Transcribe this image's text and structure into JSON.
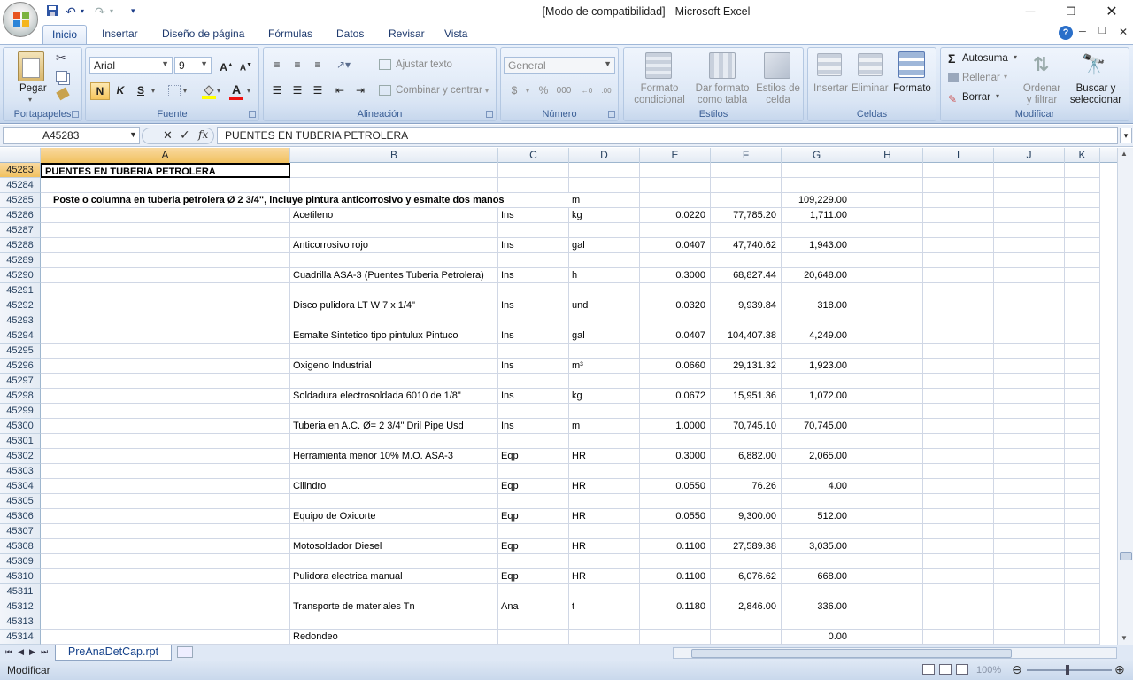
{
  "window": {
    "title": "[Modo de compatibilidad] - Microsoft Excel"
  },
  "ribbon": {
    "tabs": [
      "Inicio",
      "Insertar",
      "Diseño de página",
      "Fórmulas",
      "Datos",
      "Revisar",
      "Vista"
    ],
    "clipboard": {
      "paste": "Pegar",
      "group": "Portapapeles"
    },
    "font": {
      "name": "Arial",
      "size": "9",
      "bold": "N",
      "italic": "K",
      "underline": "S",
      "group": "Fuente"
    },
    "alignment": {
      "wrap": "Ajustar texto",
      "merge": "Combinar y centrar",
      "group": "Alineación"
    },
    "number": {
      "format": "General",
      "currency": "$",
      "percent": "%",
      "thousands": "000",
      "group": "Número"
    },
    "styles": {
      "cond": "Formato condicional",
      "table": "Dar formato como tabla",
      "cell": "Estilos de celda",
      "group": "Estilos"
    },
    "cells": {
      "insert": "Insertar",
      "delete": "Eliminar",
      "format": "Formato",
      "group": "Celdas"
    },
    "editing": {
      "autosum": "Autosuma",
      "fill": "Rellenar",
      "clear": "Borrar",
      "sort": "Ordenar y filtrar",
      "find": "Buscar y seleccionar",
      "group": "Modificar"
    }
  },
  "formula_bar": {
    "name_box": "A45283",
    "content": "PUENTES EN TUBERIA PETROLERA"
  },
  "columns": [
    "A",
    "B",
    "C",
    "D",
    "E",
    "F",
    "G",
    "H",
    "I",
    "J",
    "K"
  ],
  "rows": [
    {
      "n": "45283",
      "a": "PUENTES EN TUBERIA PETROLERA",
      "b": "",
      "c": "",
      "d": "",
      "e": "",
      "f": "",
      "g": ""
    },
    {
      "n": "45284",
      "a": "",
      "b": "",
      "c": "",
      "d": "",
      "e": "",
      "f": "",
      "g": ""
    },
    {
      "n": "45285",
      "a": "Poste o columna en tuberia petrolera Ø 2 3/4\", incluye pintura anticorrosivo y esmalte dos manos",
      "b": "",
      "c": "",
      "d": "m",
      "e": "",
      "f": "",
      "g": "109,229.00"
    },
    {
      "n": "45286",
      "a": "",
      "b": "Acetileno",
      "c": "Ins",
      "d": "kg",
      "e": "0.0220",
      "f": "77,785.20",
      "g": "1,711.00"
    },
    {
      "n": "45287",
      "a": "",
      "b": "",
      "c": "",
      "d": "",
      "e": "",
      "f": "",
      "g": ""
    },
    {
      "n": "45288",
      "a": "",
      "b": "Anticorrosivo rojo",
      "c": "Ins",
      "d": "gal",
      "e": "0.0407",
      "f": "47,740.62",
      "g": "1,943.00"
    },
    {
      "n": "45289",
      "a": "",
      "b": "",
      "c": "",
      "d": "",
      "e": "",
      "f": "",
      "g": ""
    },
    {
      "n": "45290",
      "a": "",
      "b": "Cuadrilla ASA-3 (Puentes Tuberia Petrolera)",
      "c": "Ins",
      "d": "h",
      "e": "0.3000",
      "f": "68,827.44",
      "g": "20,648.00"
    },
    {
      "n": "45291",
      "a": "",
      "b": "",
      "c": "",
      "d": "",
      "e": "",
      "f": "",
      "g": ""
    },
    {
      "n": "45292",
      "a": "",
      "b": "Disco pulidora LT W 7 x 1/4\"",
      "c": "Ins",
      "d": "und",
      "e": "0.0320",
      "f": "9,939.84",
      "g": "318.00"
    },
    {
      "n": "45293",
      "a": "",
      "b": "",
      "c": "",
      "d": "",
      "e": "",
      "f": "",
      "g": ""
    },
    {
      "n": "45294",
      "a": "",
      "b": "Esmalte Sintetico tipo pintulux Pintuco",
      "c": "Ins",
      "d": "gal",
      "e": "0.0407",
      "f": "104,407.38",
      "g": "4,249.00"
    },
    {
      "n": "45295",
      "a": "",
      "b": "",
      "c": "",
      "d": "",
      "e": "",
      "f": "",
      "g": ""
    },
    {
      "n": "45296",
      "a": "",
      "b": "Oxigeno Industrial",
      "c": "Ins",
      "d": "m³",
      "e": "0.0660",
      "f": "29,131.32",
      "g": "1,923.00"
    },
    {
      "n": "45297",
      "a": "",
      "b": "",
      "c": "",
      "d": "",
      "e": "",
      "f": "",
      "g": ""
    },
    {
      "n": "45298",
      "a": "",
      "b": "Soldadura electrosoldada 6010 de 1/8\"",
      "c": "Ins",
      "d": "kg",
      "e": "0.0672",
      "f": "15,951.36",
      "g": "1,072.00"
    },
    {
      "n": "45299",
      "a": "",
      "b": "",
      "c": "",
      "d": "",
      "e": "",
      "f": "",
      "g": ""
    },
    {
      "n": "45300",
      "a": "",
      "b": "Tuberia en A.C. Ø= 2 3/4\" Dril Pipe Usd",
      "c": "Ins",
      "d": "m",
      "e": "1.0000",
      "f": "70,745.10",
      "g": "70,745.00"
    },
    {
      "n": "45301",
      "a": "",
      "b": "",
      "c": "",
      "d": "",
      "e": "",
      "f": "",
      "g": ""
    },
    {
      "n": "45302",
      "a": "",
      "b": "Herramienta menor 10% M.O. ASA-3",
      "c": "Eqp",
      "d": "HR",
      "e": "0.3000",
      "f": "6,882.00",
      "g": "2,065.00"
    },
    {
      "n": "45303",
      "a": "",
      "b": "",
      "c": "",
      "d": "",
      "e": "",
      "f": "",
      "g": ""
    },
    {
      "n": "45304",
      "a": "",
      "b": "Cilindro",
      "c": "Eqp",
      "d": "HR",
      "e": "0.0550",
      "f": "76.26",
      "g": "4.00"
    },
    {
      "n": "45305",
      "a": "",
      "b": "",
      "c": "",
      "d": "",
      "e": "",
      "f": "",
      "g": ""
    },
    {
      "n": "45306",
      "a": "",
      "b": "Equipo de Oxicorte",
      "c": "Eqp",
      "d": "HR",
      "e": "0.0550",
      "f": "9,300.00",
      "g": "512.00"
    },
    {
      "n": "45307",
      "a": "",
      "b": "",
      "c": "",
      "d": "",
      "e": "",
      "f": "",
      "g": ""
    },
    {
      "n": "45308",
      "a": "",
      "b": "Motosoldador Diesel",
      "c": "Eqp",
      "d": "HR",
      "e": "0.1100",
      "f": "27,589.38",
      "g": "3,035.00"
    },
    {
      "n": "45309",
      "a": "",
      "b": "",
      "c": "",
      "d": "",
      "e": "",
      "f": "",
      "g": ""
    },
    {
      "n": "45310",
      "a": "",
      "b": "Pulidora electrica manual",
      "c": "Eqp",
      "d": "HR",
      "e": "0.1100",
      "f": "6,076.62",
      "g": "668.00"
    },
    {
      "n": "45311",
      "a": "",
      "b": "",
      "c": "",
      "d": "",
      "e": "",
      "f": "",
      "g": ""
    },
    {
      "n": "45312",
      "a": "",
      "b": "Transporte de materiales Tn",
      "c": "Ana",
      "d": "t",
      "e": "0.1180",
      "f": "2,846.00",
      "g": "336.00"
    },
    {
      "n": "45313",
      "a": "",
      "b": "",
      "c": "",
      "d": "",
      "e": "",
      "f": "",
      "g": ""
    },
    {
      "n": "45314",
      "a": "",
      "b": "Redondeo",
      "c": "",
      "d": "",
      "e": "",
      "f": "",
      "g": "0.00"
    }
  ],
  "sheet_tab": "PreAnaDetCap.rpt",
  "status": {
    "mode": "Modificar",
    "zoom": "100%"
  }
}
